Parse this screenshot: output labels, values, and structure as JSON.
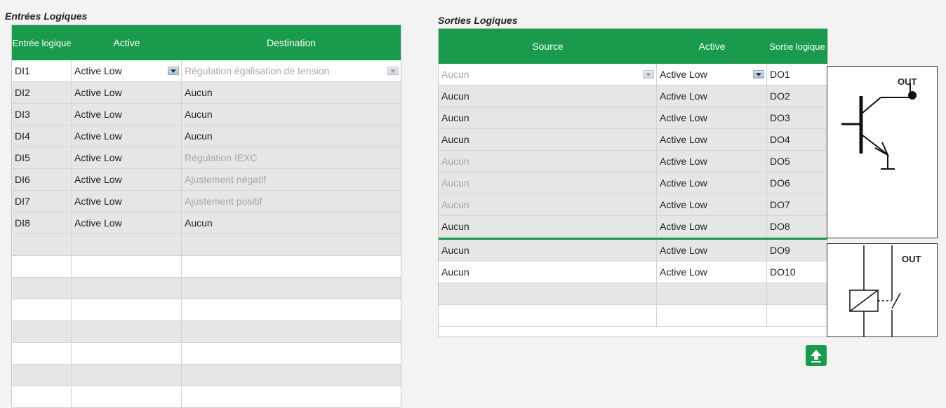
{
  "inputs": {
    "title": "Entrées Logiques",
    "headers": {
      "input": "Entrée logique",
      "active": "Active",
      "destination": "Destination"
    },
    "rows": [
      {
        "input": "DI1",
        "active": "Active Low",
        "destination": "Régulation égalisation de tension"
      },
      {
        "input": "DI2",
        "active": "Active Low",
        "destination": "Aucun"
      },
      {
        "input": "DI3",
        "active": "Active Low",
        "destination": "Aucun"
      },
      {
        "input": "DI4",
        "active": "Active Low",
        "destination": "Aucun"
      },
      {
        "input": "DI5",
        "active": "Active Low",
        "destination": "Régulation IEXC"
      },
      {
        "input": "DI6",
        "active": "Active Low",
        "destination": "Ajustement négatif"
      },
      {
        "input": "DI7",
        "active": "Active Low",
        "destination": "Ajustement positif"
      },
      {
        "input": "DI8",
        "active": "Active Low",
        "destination": "Aucun"
      }
    ]
  },
  "outputs": {
    "title": "Sorties Logiques",
    "headers": {
      "source": "Source",
      "active": "Active",
      "output": "Sortie logique"
    },
    "rows": [
      {
        "source": "Aucun",
        "active": "Active Low",
        "output": "DO1"
      },
      {
        "source": "Aucun",
        "active": "Active Low",
        "output": "DO2"
      },
      {
        "source": "Aucun",
        "active": "Active Low",
        "output": "DO3"
      },
      {
        "source": "Aucun",
        "active": "Active Low",
        "output": "DO4"
      },
      {
        "source": "Aucun",
        "active": "Active Low",
        "output": "DO5"
      },
      {
        "source": "Aucun",
        "active": "Active Low",
        "output": "DO6"
      },
      {
        "source": "Aucun",
        "active": "Active Low",
        "output": "DO7"
      },
      {
        "source": "Aucun",
        "active": "Active Low",
        "output": "DO8"
      },
      {
        "source": "Aucun",
        "active": "Active Low",
        "output": "DO9"
      },
      {
        "source": "Aucun",
        "active": "Active Low",
        "output": "DO10"
      }
    ]
  },
  "symbols": {
    "transistor_label": "OUT",
    "relay_label": "OUT"
  },
  "colors": {
    "accent": "#1a9a4c",
    "dim_text": "#a8a8a8"
  },
  "icons": {
    "upload": "upload-arrow-icon"
  }
}
